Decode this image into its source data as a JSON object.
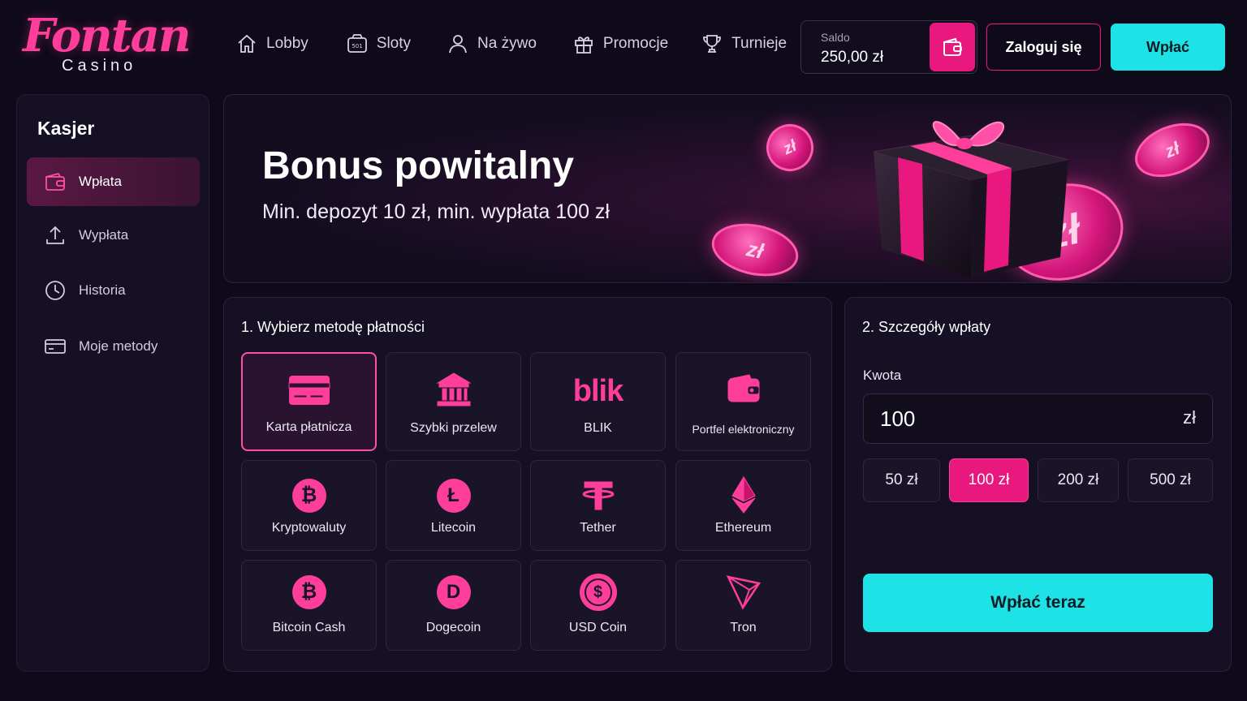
{
  "brand": {
    "name": "Fontan",
    "sub": "Casino"
  },
  "nav": [
    {
      "label": "Lobby",
      "icon": "home-icon"
    },
    {
      "label": "Sloty",
      "icon": "slot-icon"
    },
    {
      "label": "Na żywo",
      "icon": "user-icon"
    },
    {
      "label": "Promocje",
      "icon": "gift-icon"
    },
    {
      "label": "Turnieje",
      "icon": "trophy-icon"
    }
  ],
  "header": {
    "balance_label": "Saldo",
    "balance_value": "250,00 zł",
    "login_label": "Zaloguj się",
    "deposit_label": "Wpłać"
  },
  "sidebar": {
    "title": "Kasjer",
    "items": [
      {
        "label": "Wpłata",
        "icon": "wallet-icon",
        "active": true
      },
      {
        "label": "Wypłata",
        "icon": "upload-icon",
        "active": false
      },
      {
        "label": "Historia",
        "icon": "clock-icon",
        "active": false
      },
      {
        "label": "Moje metody",
        "icon": "card-icon",
        "active": false
      }
    ]
  },
  "banner": {
    "title": "Bonus powitalny",
    "subtitle": "Min. depozyt 10 zł, min. wypłata 100 zł",
    "coin_symbol": "zł"
  },
  "methods_panel": {
    "title": "1. Wybierz metodę płatności",
    "methods": [
      {
        "label": "Karta płatnicza",
        "icon": "credit-card-icon",
        "selected": true
      },
      {
        "label": "Szybki przelew",
        "icon": "bank-icon",
        "selected": false
      },
      {
        "label": "BLIK",
        "icon": "blik-icon",
        "logo_text": "blik",
        "selected": false
      },
      {
        "label": "Portfel elektroniczny",
        "icon": "wallet-icon",
        "selected": false
      },
      {
        "label": "Kryptowaluty",
        "icon": "bitcoin-icon",
        "glyph": "₿",
        "selected": false
      },
      {
        "label": "Litecoin",
        "icon": "litecoin-icon",
        "glyph": "Ł",
        "selected": false
      },
      {
        "label": "Tether",
        "icon": "tether-icon",
        "selected": false
      },
      {
        "label": "Ethereum",
        "icon": "ethereum-icon",
        "selected": false
      },
      {
        "label": "Bitcoin Cash",
        "icon": "bitcoin-cash-icon",
        "glyph": "₿",
        "selected": false
      },
      {
        "label": "Dogecoin",
        "icon": "dogecoin-icon",
        "glyph": "D",
        "selected": false
      },
      {
        "label": "USD Coin",
        "icon": "usd-coin-icon",
        "glyph": "$",
        "selected": false
      },
      {
        "label": "Tron",
        "icon": "tron-icon",
        "selected": false
      }
    ]
  },
  "details_panel": {
    "title": "2. Szczegóły wpłaty",
    "amount_label": "Kwota",
    "amount_value": "100",
    "amount_unit": "zł",
    "presets": [
      {
        "label": "50 zł",
        "selected": false
      },
      {
        "label": "100 zł",
        "selected": true
      },
      {
        "label": "200 zł",
        "selected": false
      },
      {
        "label": "500 zł",
        "selected": false
      }
    ],
    "submit_label": "Wpłać teraz"
  },
  "colors": {
    "accent_pink": "#e8187e",
    "accent_cyan": "#1de3e6",
    "background": "#0f0a1a"
  }
}
